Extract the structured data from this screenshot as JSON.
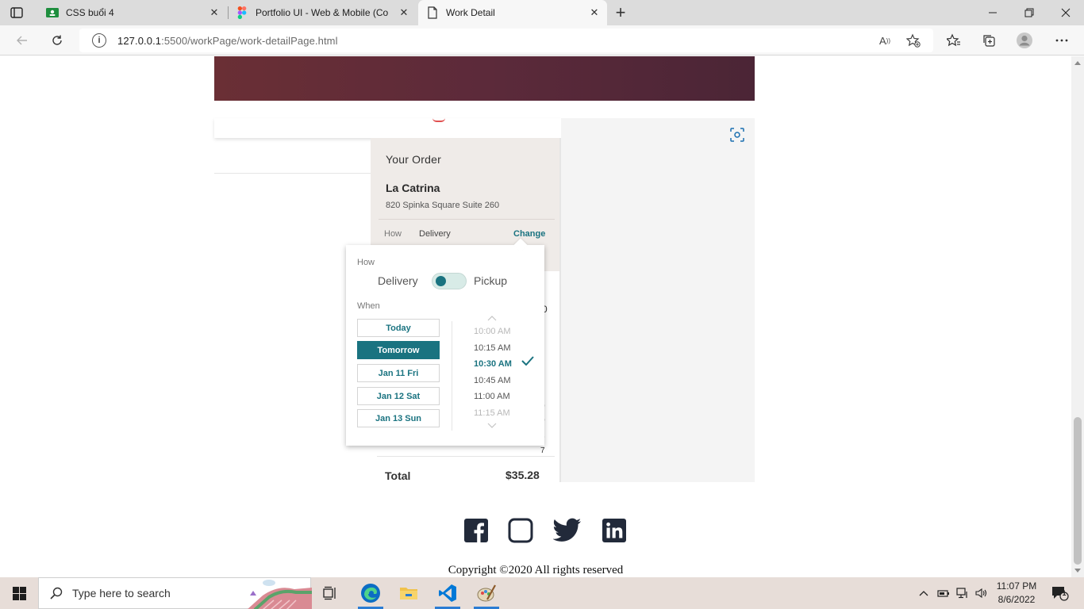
{
  "browser": {
    "tabs": [
      {
        "title": "CSS buổi 4",
        "icon": "google-classroom-icon",
        "active": false
      },
      {
        "title": "Portfolio UI - Web & Mobile (Co",
        "icon": "figma-icon",
        "active": false
      },
      {
        "title": "Work Detail",
        "icon": "page-icon",
        "active": true
      }
    ],
    "url_host": "127.0.0.1",
    "url_path": ":5500/workPage/work-detailPage.html"
  },
  "order": {
    "heading": "Your Order",
    "restaurant": "La Catrina",
    "address": "820 Spinka Square Suite 260",
    "how_label": "How",
    "how_value": "Delivery",
    "change_label": "Change",
    "total_label": "Total",
    "total_value": "$35.28",
    "peek_digits": [
      "0",
      "0",
      "0",
      "8",
      "7"
    ]
  },
  "popup": {
    "how_label": "How",
    "option_delivery": "Delivery",
    "option_pickup": "Pickup",
    "toggle_state": "delivery",
    "when_label": "When",
    "days": [
      {
        "label": "Today",
        "selected": false
      },
      {
        "label": "Tomorrow",
        "selected": true
      },
      {
        "label": "Jan 11 Fri",
        "selected": false
      },
      {
        "label": "Jan 12 Sat",
        "selected": false
      },
      {
        "label": "Jan 13 Sun",
        "selected": false
      }
    ],
    "times": [
      {
        "label": "10:00 AM",
        "state": "faded"
      },
      {
        "label": "10:15 AM",
        "state": "normal"
      },
      {
        "label": "10:30 AM",
        "state": "selected"
      },
      {
        "label": "10:45 AM",
        "state": "normal"
      },
      {
        "label": "11:00 AM",
        "state": "normal"
      },
      {
        "label": "11:15 AM",
        "state": "faded"
      }
    ]
  },
  "footer": {
    "social": [
      "facebook-icon",
      "instagram-icon",
      "twitter-icon",
      "linkedin-icon"
    ],
    "copyright": "Copyright ©2020 All rights reserved"
  },
  "taskbar": {
    "search_placeholder": "Type here to search",
    "time": "11:07 PM",
    "date": "8/6/2022",
    "notification_count": "1"
  },
  "colors": {
    "accent_teal": "#1a7380",
    "banner": "#5c2a3a",
    "order_bg": "#efebe8"
  }
}
